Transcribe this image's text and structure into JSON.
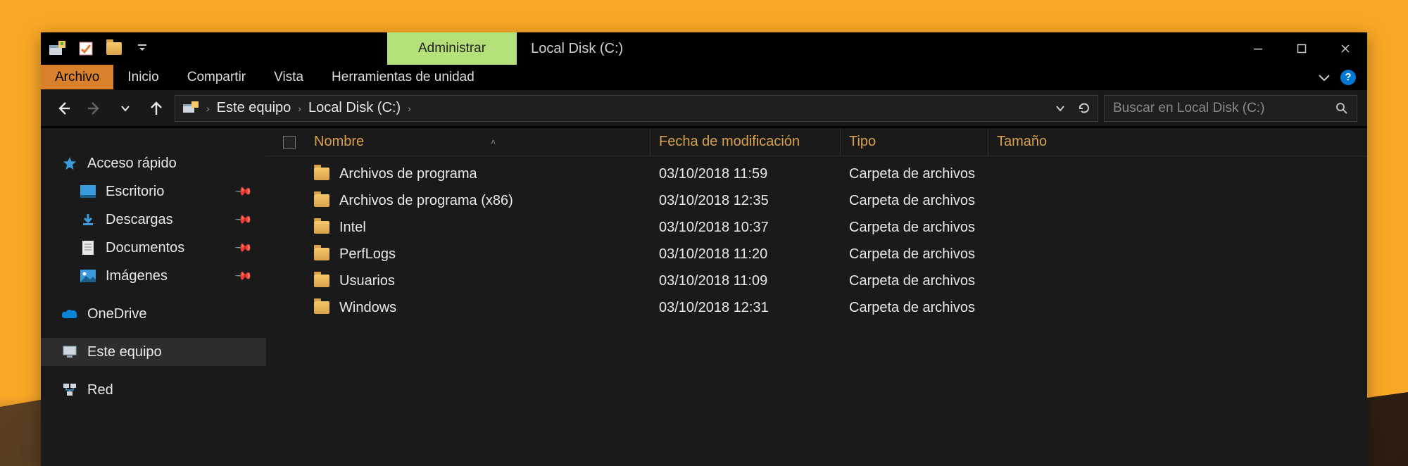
{
  "titlebar": {
    "context_tab": "Administrar",
    "window_title": "Local Disk (C:)"
  },
  "ribbon": {
    "file": "Archivo",
    "tabs": [
      "Inicio",
      "Compartir",
      "Vista",
      "Herramientas de unidad"
    ]
  },
  "breadcrumb": {
    "segments": [
      "Este equipo",
      "Local Disk (C:)"
    ]
  },
  "search": {
    "placeholder": "Buscar en Local Disk (C:)"
  },
  "sidebar": {
    "quick_access": "Acceso rápido",
    "quick_items": [
      {
        "label": "Escritorio",
        "icon": "desktop"
      },
      {
        "label": "Descargas",
        "icon": "download"
      },
      {
        "label": "Documentos",
        "icon": "document"
      },
      {
        "label": "Imágenes",
        "icon": "pictures"
      }
    ],
    "onedrive": "OneDrive",
    "this_pc": "Este equipo",
    "network": "Red"
  },
  "columns": {
    "name": "Nombre",
    "date": "Fecha de modificación",
    "type": "Tipo",
    "size": "Tamaño"
  },
  "rows": [
    {
      "name": "Archivos de programa",
      "date": "03/10/2018  11:59",
      "type": "Carpeta de archivos",
      "size": ""
    },
    {
      "name": "Archivos de programa (x86)",
      "date": "03/10/2018  12:35",
      "type": "Carpeta de archivos",
      "size": ""
    },
    {
      "name": "Intel",
      "date": "03/10/2018  10:37",
      "type": "Carpeta de archivos",
      "size": ""
    },
    {
      "name": "PerfLogs",
      "date": "03/10/2018  11:20",
      "type": "Carpeta de archivos",
      "size": ""
    },
    {
      "name": "Usuarios",
      "date": "03/10/2018  11:09",
      "type": "Carpeta de archivos",
      "size": ""
    },
    {
      "name": "Windows",
      "date": "03/10/2018  12:31",
      "type": "Carpeta de archivos",
      "size": ""
    }
  ],
  "colors": {
    "accent_orange": "#d9822b",
    "context_green": "#b4e07a",
    "header_text": "#d9a24a"
  }
}
